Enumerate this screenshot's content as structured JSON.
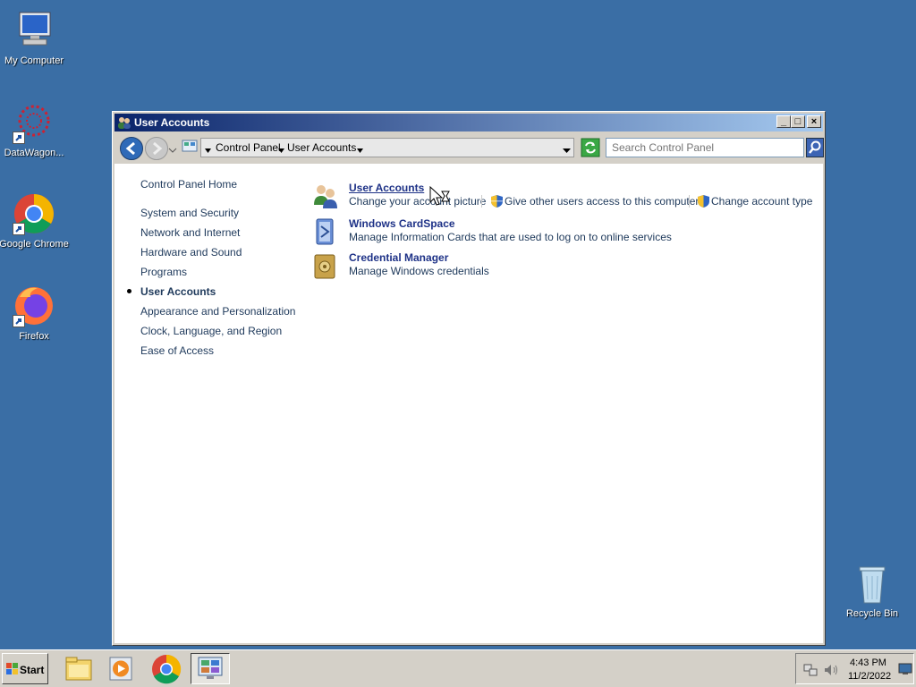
{
  "desktop": {
    "icons": [
      {
        "label": "My Computer",
        "icon": "my-computer-icon"
      },
      {
        "label": "DataWagon...",
        "icon": "datawagon-icon"
      },
      {
        "label": "Google Chrome",
        "icon": "chrome-icon"
      },
      {
        "label": "Firefox",
        "icon": "firefox-icon"
      }
    ],
    "recycle_bin": "Recycle Bin"
  },
  "window": {
    "title": "User Accounts",
    "controls": {
      "minimize": "_",
      "maximize": "□",
      "close": "×"
    },
    "address": {
      "crumbs": [
        "Control Panel",
        "User Accounts"
      ]
    },
    "search": {
      "placeholder": "Search Control Panel"
    },
    "nav": {
      "home": "Control Panel Home",
      "items": [
        {
          "label": "System and Security"
        },
        {
          "label": "Network and Internet"
        },
        {
          "label": "Hardware and Sound"
        },
        {
          "label": "Programs"
        },
        {
          "label": "User Accounts",
          "current": true
        },
        {
          "label": "Appearance and Personalization"
        },
        {
          "label": "Clock, Language, and Region"
        },
        {
          "label": "Ease of Access"
        }
      ]
    },
    "tasks": [
      {
        "title": "User Accounts",
        "links": [
          "Change your account picture",
          "Give other users access to this computer",
          "Change account type"
        ],
        "icon": "users-icon"
      },
      {
        "title": "Windows CardSpace",
        "links": [
          "Manage Information Cards that are used to log on to online services"
        ],
        "icon": "cardspace-icon"
      },
      {
        "title": "Credential Manager",
        "links": [
          "Manage Windows credentials"
        ],
        "icon": "credential-vault-icon"
      }
    ]
  },
  "taskbar": {
    "start_label": "Start",
    "apps": [
      "file-explorer-icon",
      "media-player-icon",
      "chrome-icon",
      "control-panel-icon"
    ],
    "clock": {
      "time": "4:43 PM",
      "date": "11/2/2022"
    }
  }
}
